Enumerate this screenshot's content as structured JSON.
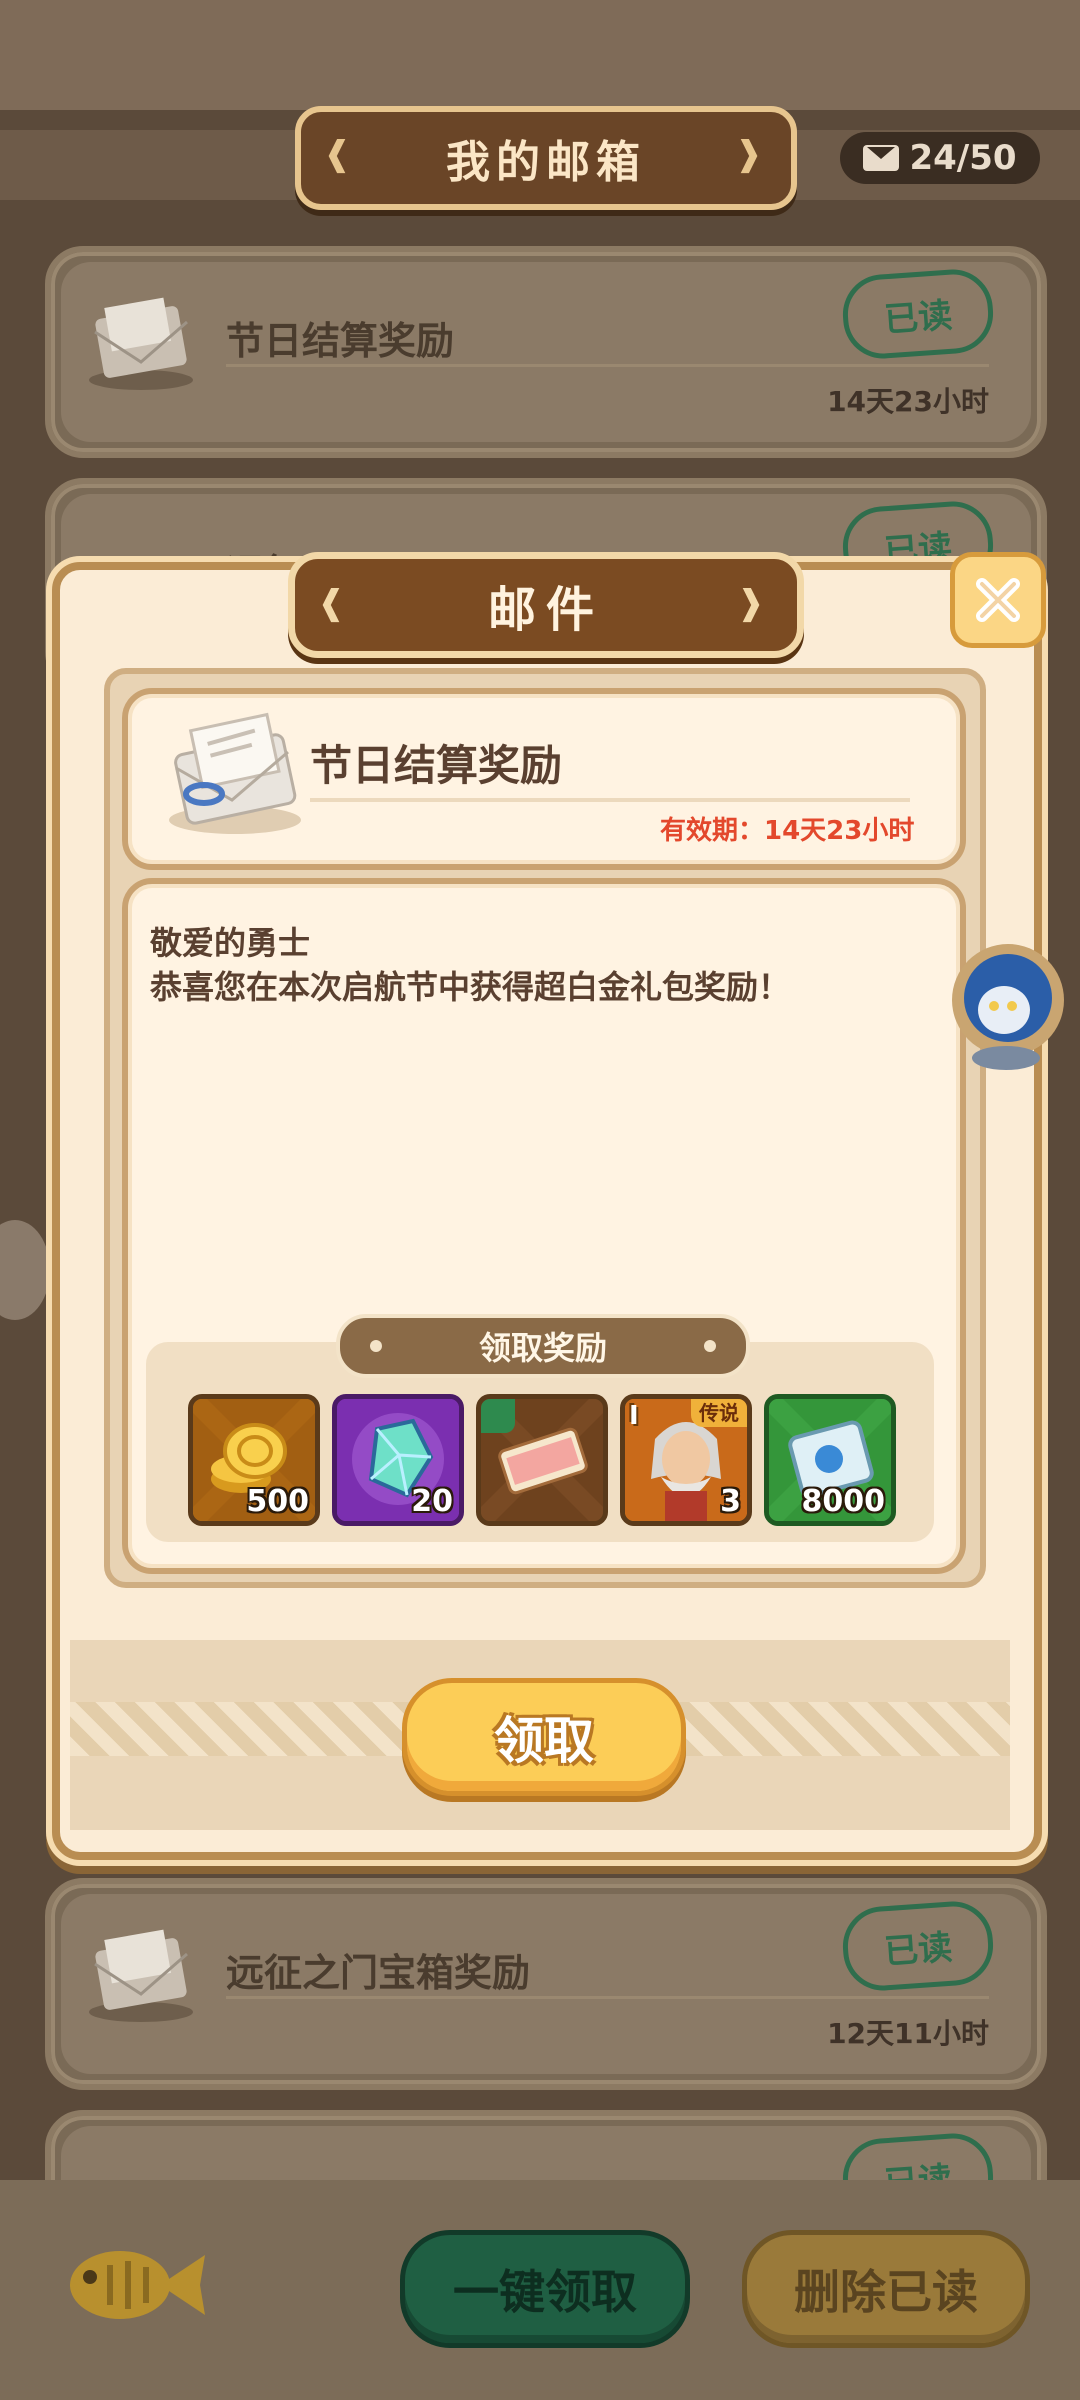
{
  "mailbox": {
    "title": "我的邮箱",
    "count": "24/50"
  },
  "mails": [
    {
      "title": "节日结算奖励",
      "status": "已读",
      "time": "14天23小时"
    },
    {
      "title": "远征之门宝箱奖励",
      "status": "已读",
      "time": ""
    },
    {
      "title": "远征之门宝箱奖励",
      "status": "已读",
      "time": "12天11小时"
    },
    {
      "title": "",
      "status": "已读",
      "time": ""
    }
  ],
  "modal": {
    "title": "邮件",
    "mail_title": "节日结算奖励",
    "validity": "有效期：14天23小时",
    "greeting": "敬爱的勇士",
    "content": "恭喜您在本次启航节中获得超白金礼包奖励！",
    "reward_label": "领取奖励",
    "rewards": [
      {
        "name": "gold-coins",
        "count": "500"
      },
      {
        "name": "rainbow-crystal",
        "count": "20"
      },
      {
        "name": "ticket",
        "count": ""
      },
      {
        "name": "hero-portrait",
        "count": "3",
        "rank": "I",
        "tag": "传说"
      },
      {
        "name": "scroll",
        "count": "8000"
      }
    ],
    "claim_button": "领取"
  },
  "bottom": {
    "claim_all": "一键领取",
    "delete_read": "删除已读"
  },
  "colors": {
    "accent_gold": "#fccd57",
    "validity_red": "#e3482c",
    "read_green": "#2f6e4d"
  }
}
